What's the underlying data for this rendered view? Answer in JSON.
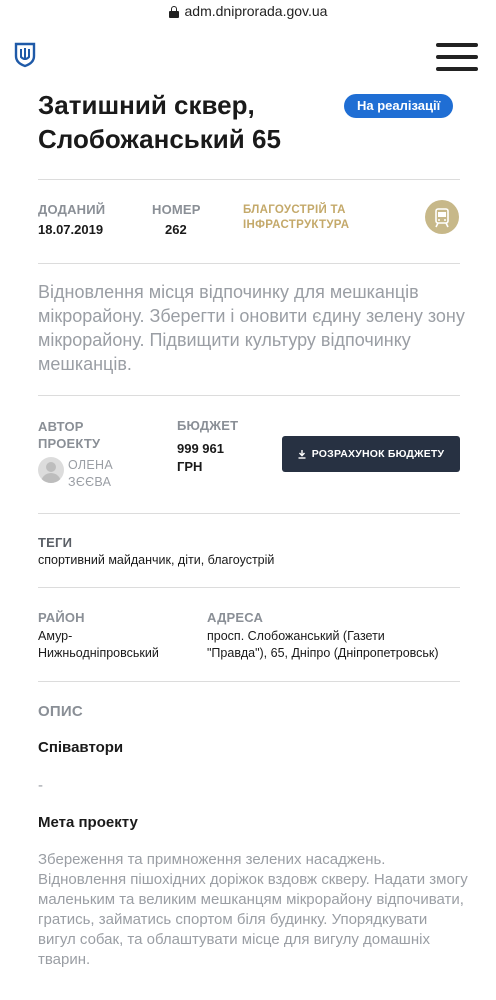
{
  "browser": {
    "url": "adm.dniprorada.gov.ua"
  },
  "header": {
    "logo_icon": "trident-shield-icon",
    "menu_icon": "hamburger-menu-icon"
  },
  "project": {
    "title_line1": "Затишний сквер,",
    "title_line2": "Слобожанський 65",
    "status": "На реалізації",
    "status_color": "#1f6ed4"
  },
  "meta": {
    "added_label": "ДОДАНИЙ",
    "added_value": "18.07.2019",
    "number_label": "НОМЕР",
    "number_value": "262",
    "category_line1": "БЛАГОУСТРІЙ ТА",
    "category_line2": "ІНФРАСТРУКТУРА",
    "category_icon": "tram-icon",
    "category_color": "#c4a96a"
  },
  "summary": "Відновлення місця відпочинку для мешканців мікрорайону. Зберегти і оновити єдину зелену зону мікрорайону. Підвищити культуру відпочинку мешканців.",
  "author": {
    "label_line1": "АВТОР",
    "label_line2": "ПРОЕКТУ",
    "name_line1": "ОЛЕНА",
    "name_line2": "ЗЄЄВА"
  },
  "budget": {
    "label": "БЮДЖЕТ",
    "value_line1": "999 961",
    "value_line2": "ГРН",
    "button_label": "РОЗРАХУНОК БЮДЖЕТУ"
  },
  "tags": {
    "label": "ТЕГИ",
    "value": "спортивний майданчик, діти, благоустрій"
  },
  "district": {
    "label": "РАЙОН",
    "value_line1": "Амур-",
    "value_line2": "Нижньодніпровський"
  },
  "address": {
    "label": "АДРЕСА",
    "value_line1": "просп. Слобожанський (Газети",
    "value_line2": "\"Правда\"), 65, Дніпро (Дніпропетровськ)"
  },
  "description": {
    "label": "ОПИС",
    "coauthors_heading": "Співавтори",
    "coauthors_value": "-",
    "goal_heading": "Мета проекту",
    "goal_text": "Збереження та примноження зелених насаджень. Відновлення пішохідних доріжок вздовж скверу. Надати змогу маленьким та великим мешканцям мікрорайону відпочивати, гратись, займатись спортом біля будинку. Упорядкувати вигул собак, та облаштувати місце для вигулу домашніх тварин."
  }
}
